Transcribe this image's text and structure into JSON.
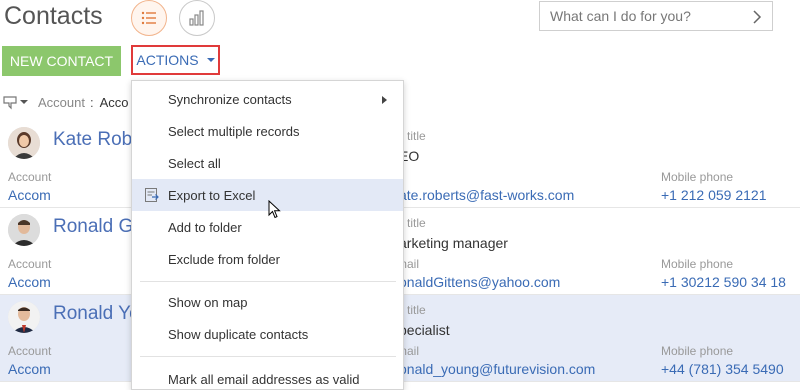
{
  "header": {
    "title": "Contacts",
    "list_view_icon": "list-icon",
    "analytics_icon": "bar-chart-icon",
    "search_placeholder": "What can I do for you?"
  },
  "toolbar": {
    "new_contact_label": "NEW CONTACT",
    "actions_label": "ACTIONS"
  },
  "filter": {
    "label": "Account",
    "separator": ":",
    "value": "Acco"
  },
  "contacts": [
    {
      "name": "Kate Robe",
      "account_label": "Account",
      "account_value": "Accom",
      "job_title_label": "b title",
      "job_title_value": "EO",
      "email_label": "",
      "email_value": "ate.roberts@fast-works.com",
      "mobile_label": "Mobile phone",
      "mobile_value": "+1 212 059 2121"
    },
    {
      "name": "Ronald G",
      "account_label": "Account",
      "account_value": "Accom",
      "job_title_label": "b title",
      "job_title_value": "arketing manager",
      "email_label": "mail",
      "email_value": "onaldGittens@yahoo.com",
      "mobile_label": "Mobile phone",
      "mobile_value": "+1 30212 590 34 18"
    },
    {
      "name": "Ronald Yo",
      "account_label": "Account",
      "account_value": "Accom",
      "job_title_label": "b title",
      "job_title_value": "pecialist",
      "email_label": "mail",
      "email_value": "onald_young@futurevision.com",
      "mobile_label": "Mobile phone",
      "mobile_value": "+44 (781) 354 5490"
    }
  ],
  "actions_menu": {
    "items": [
      "Synchronize contacts",
      "Select multiple records",
      "Select all",
      "Export to Excel",
      "Add to folder",
      "Exclude from folder",
      "Show on map",
      "Show duplicate contacts",
      "Mark all email addresses as valid"
    ],
    "hovered": "Export to Excel"
  },
  "colors": {
    "accent_green": "#8cc76c",
    "link_blue": "#3a6bb5",
    "highlight_red": "#e03a3a",
    "selected_row": "#e6ebf7"
  }
}
